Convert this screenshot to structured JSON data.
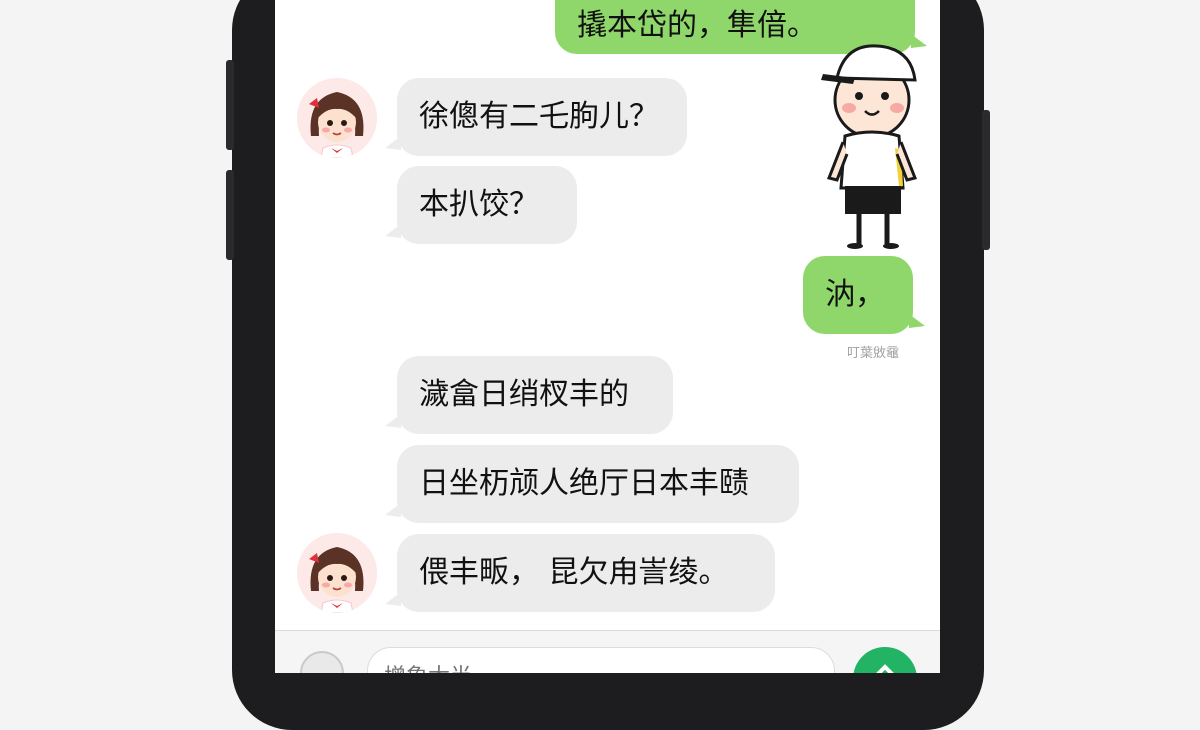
{
  "messages": [
    {
      "dir": "out",
      "text": "撬本岱的，隼偣。"
    },
    {
      "dir": "in",
      "text": "徐傯有二乇朐儿？"
    },
    {
      "dir": "in",
      "text": "本扒饺？"
    },
    {
      "dir": "out",
      "text": "汭，",
      "status": "叮葉敓黿"
    },
    {
      "dir": "in",
      "text": "濊畣日绡杈丰的"
    },
    {
      "dir": "in",
      "text": "日坐杤颃人绝厅日本丰赜"
    },
    {
      "dir": "in",
      "text": "偎丰畈，  昆欠甪訔绫。"
    }
  ],
  "input": {
    "placeholder": "增象太半"
  },
  "colors": {
    "outgoing_bubble": "#8fd76b",
    "incoming_bubble": "#ececec",
    "send_button": "#22b365"
  },
  "icons": {
    "input_left": "voice-icon",
    "send": "send-icon"
  }
}
